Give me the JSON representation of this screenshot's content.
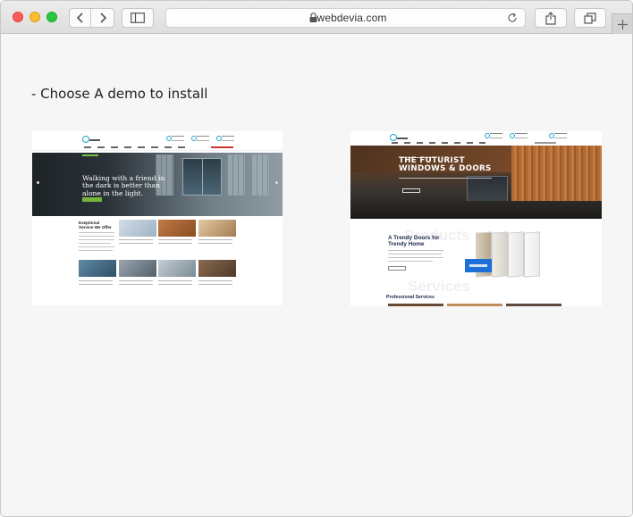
{
  "browser": {
    "url": "webdevia.com",
    "buttons": {
      "back": "back-icon",
      "forward": "forward-icon",
      "sidebar": "sidebar-icon",
      "share": "share-icon",
      "tabs": "tabs-icon",
      "reload": "reload-icon",
      "new_tab": "plus-icon"
    },
    "lock_icon": "lock-icon"
  },
  "main": {
    "heading": "- Choose A demo to install",
    "demos": [
      {
        "hero_text": "Walking with a friend in the dark is better than alone in the light.",
        "section_title": "Exeptional Service We Offer"
      },
      {
        "hero_title": "THE FUTURIST WINDOWS & DOORS",
        "section_title": "A Trendy Doors for Trendy Home",
        "ghost_text_1": "Products",
        "ghost_text_2": "Services",
        "services_title": "Professional Services"
      }
    ]
  },
  "colors": {
    "accent_teal": "#1fa3c7",
    "accent_green": "#74b63c",
    "accent_blue": "#1d6fd8",
    "navy": "#1c2b4a"
  }
}
